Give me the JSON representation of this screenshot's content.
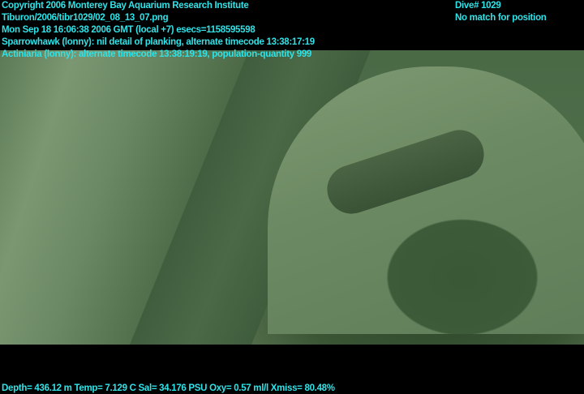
{
  "overlay": {
    "copyright": "Copyright 2006 Monterey Bay Aquarium Research Institute",
    "file": "Tiburon/2006/tibr1029/02_08_13_07.png",
    "datetime": "Mon Sep 18 16:06:38 2006 GMT (local +7)  esecs=1158595598",
    "annotation1": "Sparrowhawk (lonny): nil detail of planking, alternate timecode 13:38:17:19",
    "annotation2": "Actiniaria (lonny): alternate timecode 13:38:19:19, population-quantity 999",
    "dive": "Dive# 1029",
    "position": "No match for position",
    "sensors": "Depth= 436.12 m  Temp= 7.129 C  Sal= 34.176 PSU  Oxy= 0.57 ml/l  Xmiss= 80.48%"
  },
  "colors": {
    "text": "#2fe3e8",
    "background": "#000000"
  }
}
